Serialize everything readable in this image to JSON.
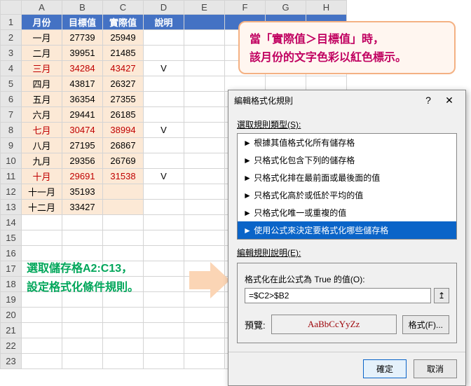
{
  "columns": [
    "A",
    "B",
    "C",
    "D",
    "E",
    "F",
    "G",
    "H"
  ],
  "rowcount": 23,
  "header": {
    "a": "月份",
    "b": "目標值",
    "c": "實際值",
    "d": "說明"
  },
  "rows": [
    {
      "a": "一月",
      "b": "27739",
      "c": "25949",
      "d": "",
      "red": false
    },
    {
      "a": "二月",
      "b": "39951",
      "c": "21485",
      "d": "",
      "red": false
    },
    {
      "a": "三月",
      "b": "34284",
      "c": "43427",
      "d": "V",
      "red": true
    },
    {
      "a": "四月",
      "b": "43817",
      "c": "26327",
      "d": "",
      "red": false
    },
    {
      "a": "五月",
      "b": "36354",
      "c": "27355",
      "d": "",
      "red": false
    },
    {
      "a": "六月",
      "b": "29441",
      "c": "26185",
      "d": "",
      "red": false
    },
    {
      "a": "七月",
      "b": "30474",
      "c": "38994",
      "d": "V",
      "red": true
    },
    {
      "a": "八月",
      "b": "27195",
      "c": "26867",
      "d": "",
      "red": false
    },
    {
      "a": "九月",
      "b": "29356",
      "c": "26769",
      "d": "",
      "red": false
    },
    {
      "a": "十月",
      "b": "29691",
      "c": "31538",
      "d": "V",
      "red": true
    },
    {
      "a": "十一月",
      "b": "35193",
      "c": "",
      "d": "",
      "red": false
    },
    {
      "a": "十二月",
      "b": "33427",
      "c": "",
      "d": "",
      "red": false
    }
  ],
  "note1_l1": "當「實際值＞目標值」時，",
  "note1_l2": "該月份的文字色彩以紅色標示。",
  "note2_l1": "選取儲存格A2:C13，",
  "note2_l2": "設定格式化條件規則。",
  "dialog": {
    "title": "編輯格式化規則",
    "help": "?",
    "close": "✕",
    "select_type": "選取規則類型(S):",
    "rules": [
      "► 根據其值格式化所有儲存格",
      "► 只格式化包含下列的儲存格",
      "► 只格式化排在最前面或最後面的值",
      "► 只格式化高於或低於平均的值",
      "► 只格式化唯一或重複的值",
      "► 使用公式來決定要格式化哪些儲存格"
    ],
    "edit_desc": "編輯規則說明(E):",
    "formula_label": "格式化在此公式為 True 的值(O):",
    "formula": "=$C2>$B2",
    "preview_label": "預覽:",
    "preview_text": "AaBbCcYyZz",
    "format_btn": "格式(F)...",
    "ok": "確定",
    "cancel": "取消"
  }
}
